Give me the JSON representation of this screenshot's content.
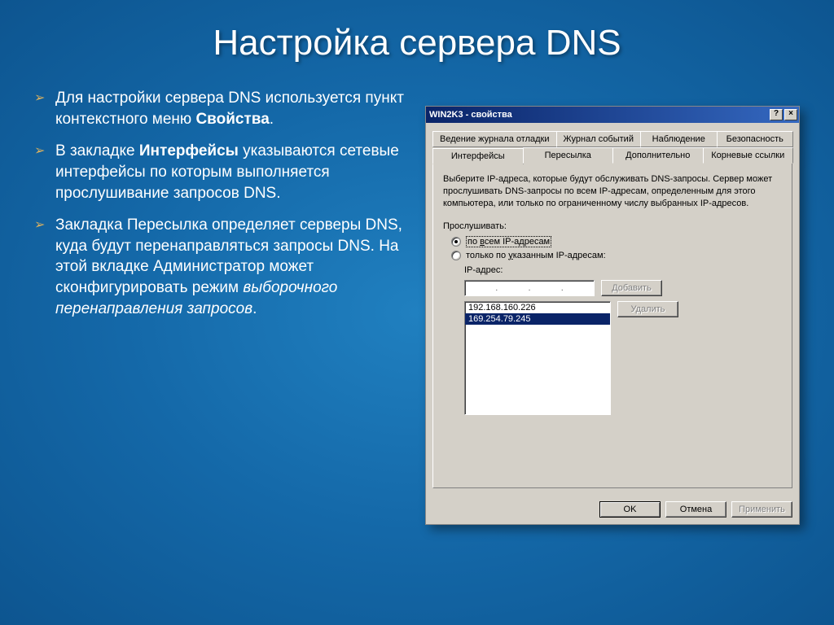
{
  "slide": {
    "title": "Настройка сервера DNS",
    "bullets": [
      {
        "pre": "Для настройки сервера DNS используется пункт контекстного меню ",
        "bold": "Свойства",
        "post": "."
      },
      {
        "pre": "В закладке ",
        "bold": "Интерфейсы",
        "post": " указываются сетевые интерфейсы по которым выполняется прослушивание запросов DNS."
      },
      {
        "pre": "Закладка Пересылка определяет серверы DNS, куда будут перенаправляться запросы DNS. На этой вкладке Администратор может сконфигурировать режим ",
        "italic": "выборочного перенаправления запросов",
        "post": "."
      }
    ]
  },
  "dialog": {
    "title": "WIN2K3 - свойства",
    "help": "?",
    "close": "×",
    "tabs_row1": [
      "Ведение журнала отладки",
      "Журнал событий",
      "Наблюдение",
      "Безопасность"
    ],
    "tabs_row2": [
      "Интерфейсы",
      "Пересылка",
      "Дополнительно",
      "Корневые ссылки"
    ],
    "active_tab": "Интерфейсы",
    "panel": {
      "description": "Выберите IP-адреса, которые будут обслуживать DNS-запросы. Сервер может прослушивать DNS-запросы по всем IP-адресам, определенным для этого компьютера, или только по ограниченному числу выбранных IP-адресов.",
      "listen_label": "Прослушивать:",
      "radio_all": {
        "prefix": "по ",
        "u": "в",
        "suffix": "сем IP-адресам",
        "checked": true
      },
      "radio_some": {
        "prefix": "только по ",
        "u": "у",
        "suffix": "казанным IP-адресам:",
        "checked": false
      },
      "ip_label": "IP-адрес:",
      "add_btn": "Добавить",
      "del_btn": "Удалить",
      "list": [
        "192.168.160.226",
        "169.254.79.245"
      ],
      "selected_index": 1
    },
    "buttons": {
      "ok": "OK",
      "cancel": "Отмена",
      "apply": "Применить"
    }
  }
}
